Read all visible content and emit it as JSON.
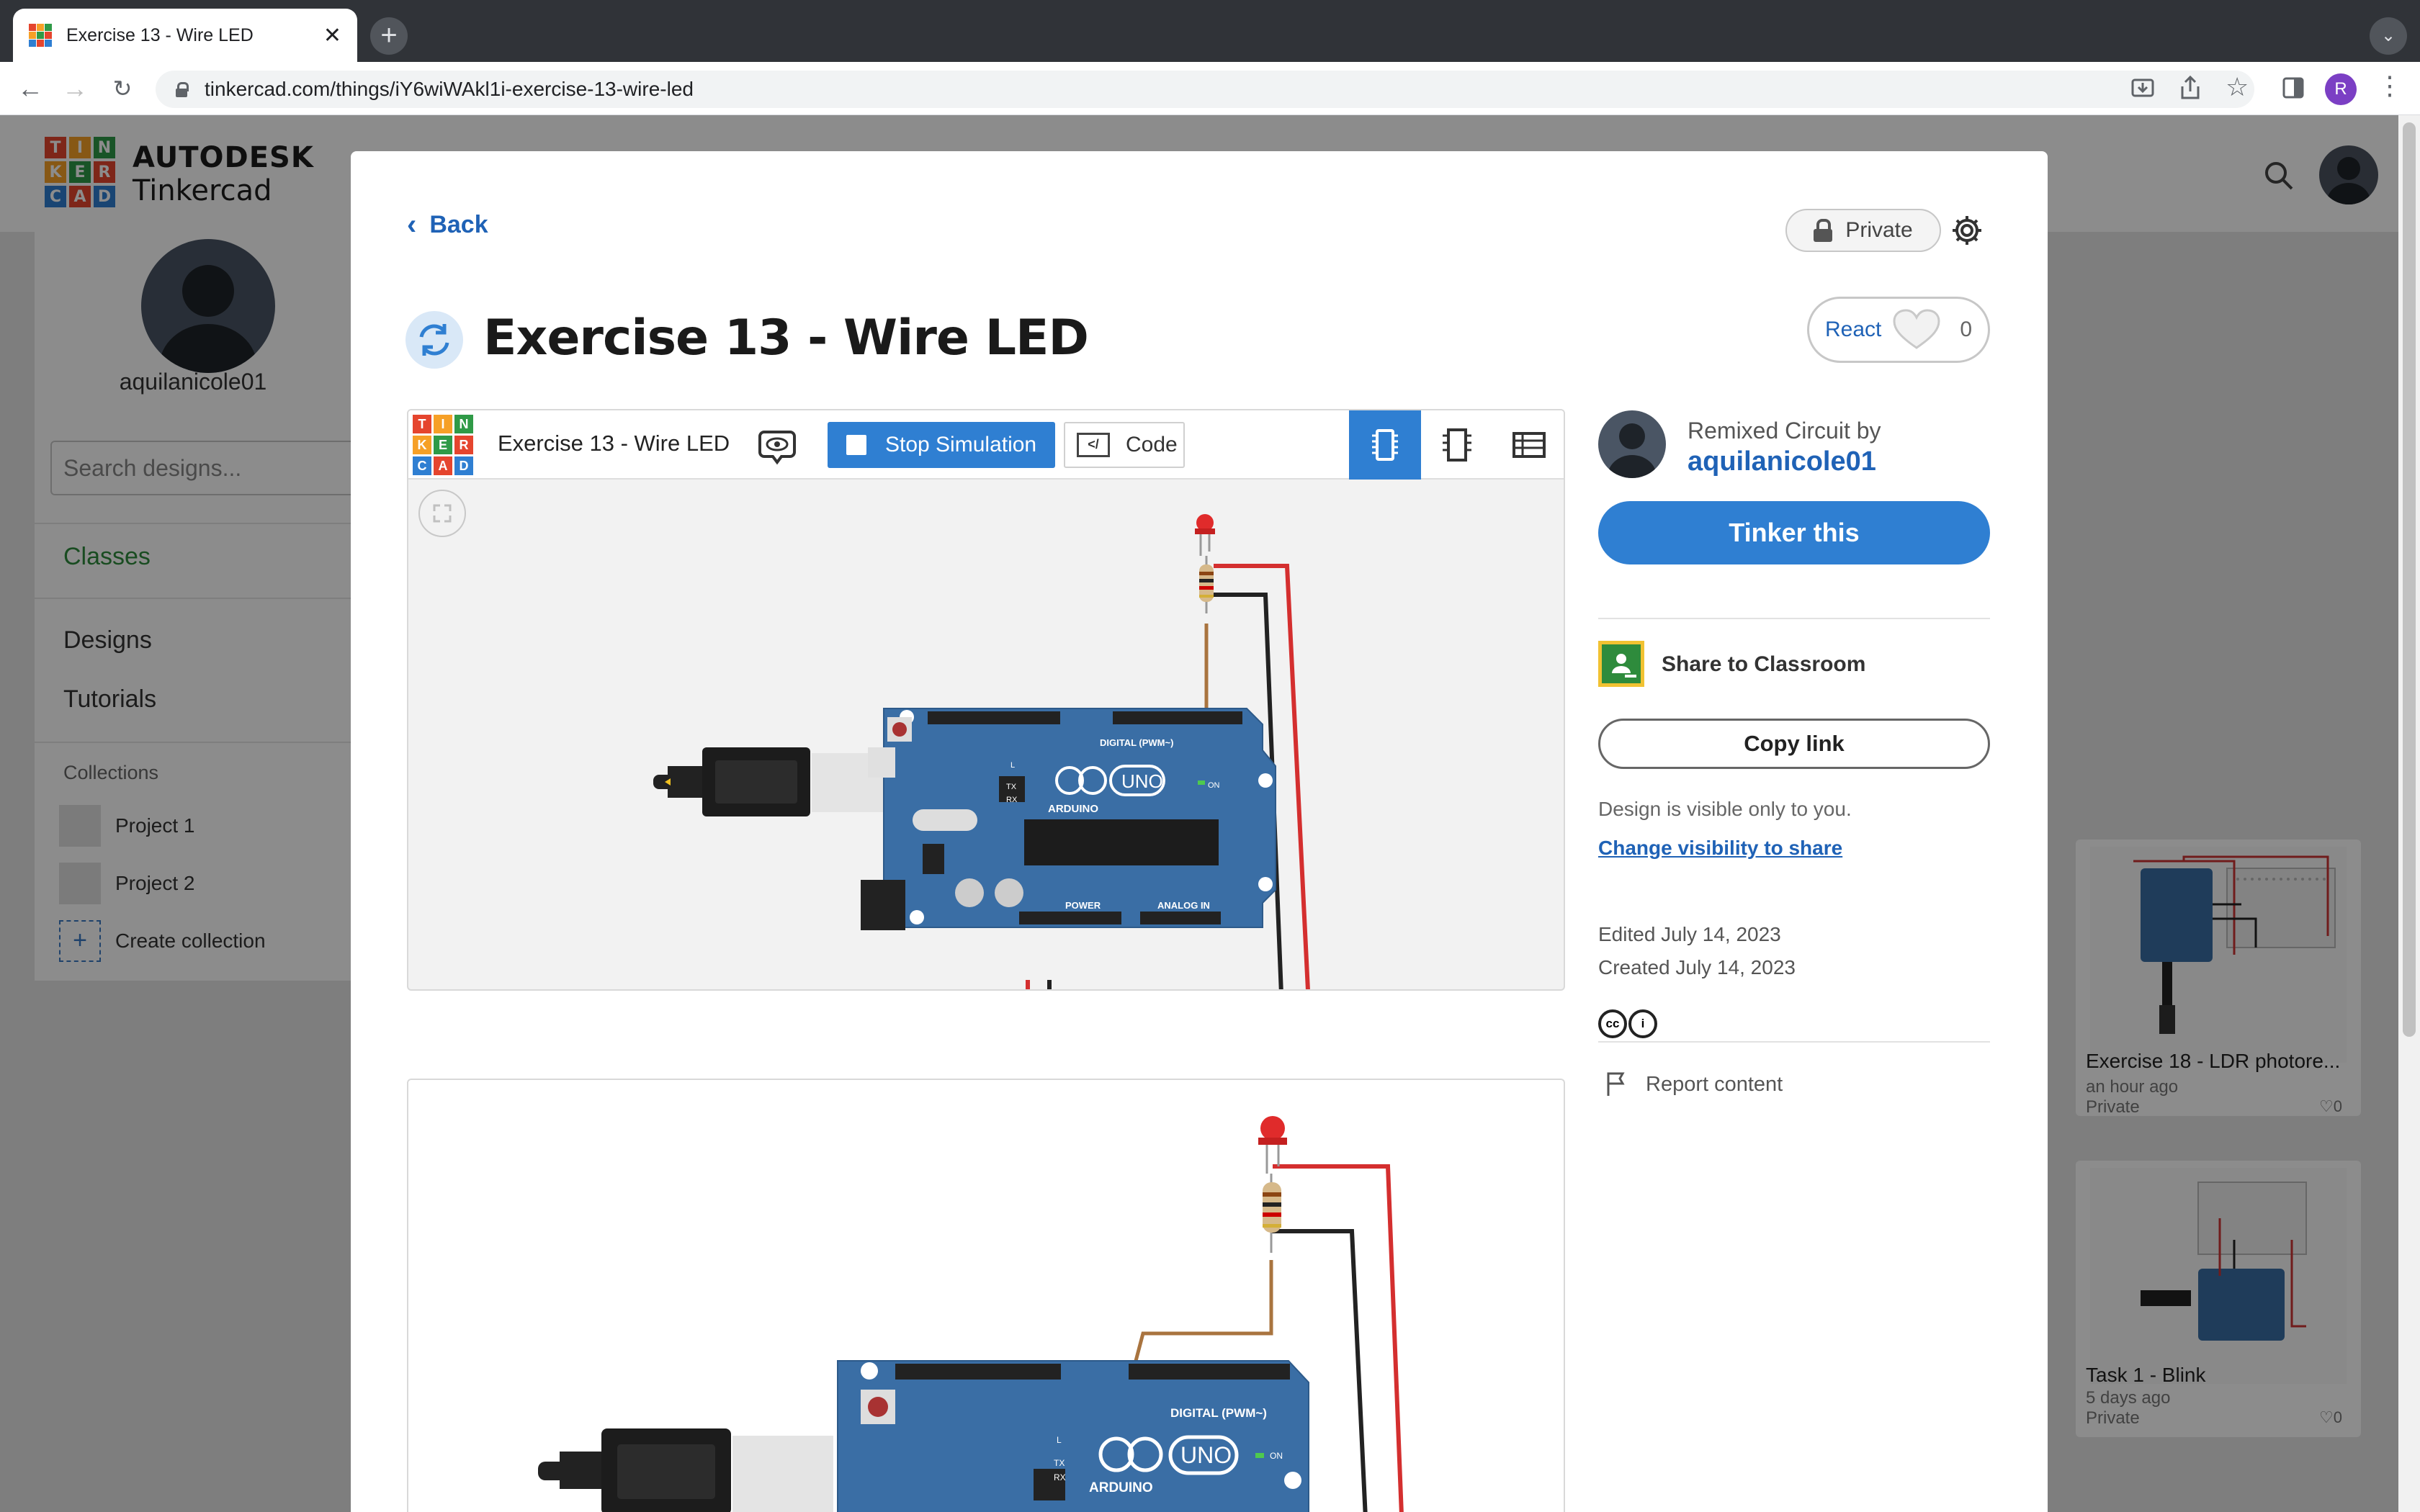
{
  "browser": {
    "tab_title": "Exercise 13 - Wire LED",
    "url": "tinkercad.com/things/iY6wiWAkl1i-exercise-13-wire-led",
    "profile_initial": "R"
  },
  "site": {
    "brand_line1": "AUTODESK",
    "brand_line2": "Tinkercad",
    "logo_letters": [
      "T",
      "I",
      "N",
      "K",
      "E",
      "R",
      "C",
      "A",
      "D"
    ],
    "logo_colors": [
      "#e5452e",
      "#f6a027",
      "#2f9a47",
      "#f6a027",
      "#2f9a47",
      "#e5452e",
      "#2f7fd2",
      "#e5452e",
      "#2f7fd2"
    ]
  },
  "sidebar": {
    "username": "aquilanicole01",
    "search_placeholder": "Search designs...",
    "classes_label": "Classes",
    "designs_label": "Designs",
    "tutorials_label": "Tutorials",
    "collections_heading": "Collections",
    "collections": [
      "Project 1",
      "Project 2"
    ],
    "create_collection": "Create collection"
  },
  "cards": [
    {
      "title": "Exercise 18 - LDR photore...",
      "time": "an hour ago",
      "visibility": "Private",
      "likes": "0"
    },
    {
      "title": "Task 1 - Blink",
      "time": "5 days ago",
      "visibility": "Private",
      "likes": "0"
    }
  ],
  "modal": {
    "back_label": "Back",
    "privacy_label": "Private",
    "title": "Exercise 13 - Wire LED",
    "react_label": "React",
    "react_count": "0",
    "viewer": {
      "title": "Exercise 13 - Wire LED",
      "stop_label": "Stop Simulation",
      "code_label": "Code"
    },
    "board": {
      "digital_label": "DIGITAL (PWM~)",
      "brand": "ARDUINO",
      "model": "UNO",
      "power_label": "POWER",
      "analog_label": "ANALOG IN",
      "on_label": "ON",
      "tx_label": "TX",
      "rx_label": "RX",
      "l_label": "L"
    },
    "author": {
      "remixed_label": "Remixed Circuit by",
      "name": "aquilanicole01"
    },
    "tinker_label": "Tinker this",
    "classroom_label": "Share to Classroom",
    "copy_label": "Copy link",
    "visibility_text": "Design is visible only to you.",
    "visibility_link": "Change visibility to share",
    "edited": "Edited July 14, 2023",
    "created": "Created July 14, 2023",
    "report_label": "Report content"
  },
  "colors": {
    "accent": "#2f7fd2",
    "link": "#1f62b6",
    "arduino_board": "#3a6ea5",
    "wire_red": "#d42f2f",
    "wire_black": "#222222",
    "wire_brown": "#a9743f"
  }
}
